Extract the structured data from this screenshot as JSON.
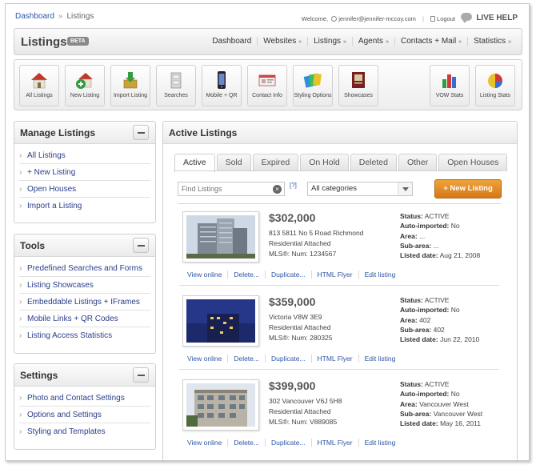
{
  "breadcrumb": {
    "root": "Dashboard",
    "current": "Listings"
  },
  "user_bar": {
    "welcome": "Welcome,",
    "email": "jennifer@jennifer-mccoy.com",
    "logout": "Logout",
    "live_help": "LIVE HELP"
  },
  "app": {
    "title": "Listings",
    "badge": "BETA"
  },
  "main_nav": [
    {
      "label": "Dashboard",
      "has_menu": false
    },
    {
      "label": "Websites",
      "has_menu": true
    },
    {
      "label": "Listings",
      "has_menu": true
    },
    {
      "label": "Agents",
      "has_menu": true
    },
    {
      "label": "Contacts + Mail",
      "has_menu": true
    },
    {
      "label": "Statistics",
      "has_menu": true
    }
  ],
  "toolbar": {
    "all_listings": "All Listings",
    "new_listing": "New Listing",
    "import_listing": "Import Listing",
    "searches": "Searches",
    "mobile_qr": "Mobile + QR",
    "contact_info": "Contact Info",
    "styling_options": "Styling Options",
    "showcases": "Showcases",
    "vow_stats": "VOW Stats",
    "listing_stats": "Listing Stats"
  },
  "manage_listings": {
    "title": "Manage Listings",
    "items": [
      "All Listings",
      "+ New Listing",
      "Open Houses",
      "Import a Listing"
    ]
  },
  "tools": {
    "title": "Tools",
    "items": [
      "Predefined Searches and Forms",
      "Listing Showcases",
      "Embeddable Listings + IFrames",
      "Mobile Links + QR Codes",
      "Listing Access Statistics"
    ]
  },
  "settings": {
    "title": "Settings",
    "items": [
      "Photo and Contact Settings",
      "Options and Settings",
      "Styling and Templates"
    ]
  },
  "active_listings": {
    "title": "Active Listings",
    "tabs": [
      "Active",
      "Sold",
      "Expired",
      "On Hold",
      "Deleted",
      "Other",
      "Open Houses"
    ],
    "active_tab": "Active",
    "search_placeholder": "Find Listings",
    "help": "[?]",
    "category_selected": "All categories",
    "new_listing_button": "+ New Listing",
    "action_labels": {
      "view": "View online",
      "delete": "Delete...",
      "duplicate": "Duplicate...",
      "flyer": "HTML Flyer",
      "edit": "Edit listing"
    },
    "field_labels": {
      "status": "Status",
      "auto_imported": "Auto-imported",
      "area": "Area",
      "sub_area": "Sub-area",
      "listed_date": "Listed date"
    },
    "listings": [
      {
        "price": "$302,000",
        "address": "813 5811 No 5 Road Richmond",
        "type": "Residential Attached",
        "mls": "MLS®: Num: 1234567",
        "status": "ACTIVE",
        "auto_imported": "No",
        "area": "...",
        "sub_area": "...",
        "listed_date": "Aug 21, 2008"
      },
      {
        "price": "$359,000",
        "address": "Victoria V8W 3E9",
        "type": "Residential Attached",
        "mls": "MLS®: Num: 280325",
        "status": "ACTIVE",
        "auto_imported": "No",
        "area": "402",
        "sub_area": "402",
        "listed_date": "Jun 22, 2010"
      },
      {
        "price": "$399,900",
        "address": "302 Vancouver V6J 5H8",
        "type": "Residential Attached",
        "mls": "MLS®: Num: V889085",
        "status": "ACTIVE",
        "auto_imported": "No",
        "area": "Vancouver West",
        "sub_area": "Vancouver West",
        "listed_date": "May 16, 2011"
      }
    ]
  }
}
